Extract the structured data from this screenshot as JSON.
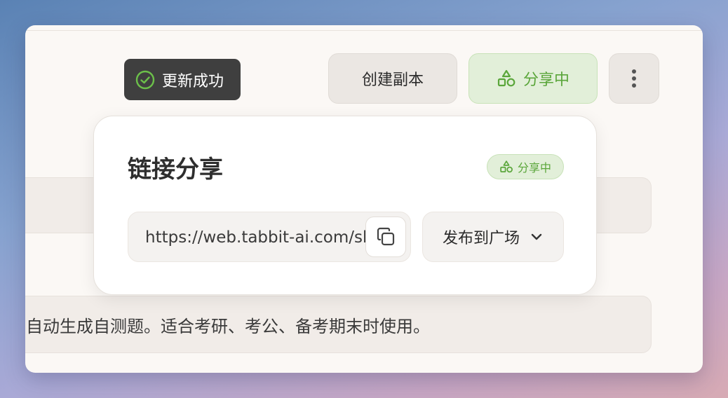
{
  "toast": {
    "text": "更新成功",
    "icon": "check-circle-icon"
  },
  "toolbar": {
    "copy_label": "创建副本",
    "share_label": "分享中",
    "share_icon": "shapes-icon",
    "more_icon": "vertical-dots-icon"
  },
  "content": {
    "row2_text": "自动生成自测题。适合考研、考公、备考期末时使用。"
  },
  "share_popup": {
    "title": "链接分享",
    "badge": "分享中",
    "url": "https://web.tabbit-ai.com/share",
    "copy_icon": "copy-icon",
    "publish_label": "发布到广场",
    "publish_icon": "chevron-down-icon"
  },
  "colors": {
    "accent_green": "#5aa63a",
    "toast_bg": "#3f3f3f",
    "window_bg": "#fbf8f5"
  }
}
